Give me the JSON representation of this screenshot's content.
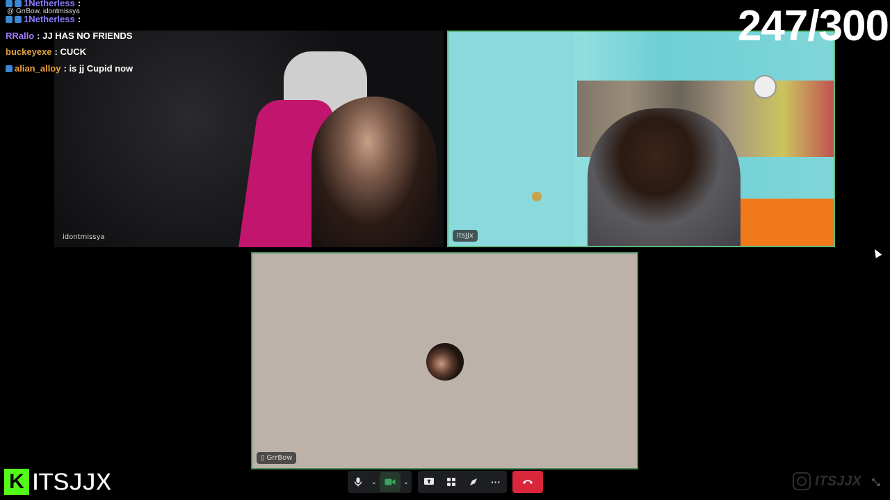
{
  "counter": "247/300",
  "chat": {
    "top_reply": "GrrBow, idontmissya",
    "messages": [
      {
        "user": "1Netherless",
        "msg": "",
        "color": "#8a7cff"
      },
      {
        "user": "1Netherless",
        "msg": "",
        "color": "#8a7cff"
      },
      {
        "user": "RRallo",
        "msg": "JJ HAS NO FRIENDS",
        "color": "#a27cff"
      },
      {
        "user": "buckeyexe",
        "msg": "CUCK",
        "color": "#e0a23a"
      },
      {
        "user": "alian_alloy",
        "msg": "is jj Cupid now",
        "color": "#f0a23a"
      }
    ]
  },
  "participants": {
    "tile_a": {
      "name": "idontmissya"
    },
    "tile_b": {
      "name": "ItsJJx"
    },
    "tile_c": {
      "name": "GrrBow"
    }
  },
  "toolbar": {
    "mic_icon": "microphone-icon",
    "camera_icon": "camera-icon",
    "share_icon": "screen-share-icon",
    "activities_icon": "activities-icon",
    "soundboard_icon": "soundboard-icon",
    "more_icon": "more-icon",
    "hangup_icon": "phone-hangup-icon",
    "hangup_color": "#d9263b",
    "camera_active_color": "#3ba55d"
  },
  "branding": {
    "logo_text": "ITSJJX",
    "watermark_text": "ITSJJX"
  }
}
